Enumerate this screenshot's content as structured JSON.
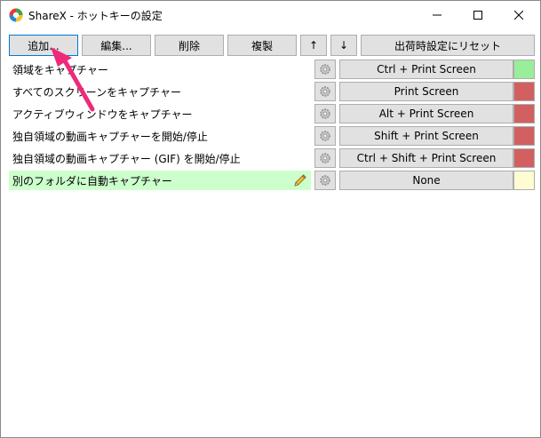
{
  "window": {
    "title": "ShareX - ホットキーの設定"
  },
  "toolbar": {
    "add_label": "追加...",
    "edit_label": "編集...",
    "delete_label": "削除",
    "duplicate_label": "複製",
    "up_label": "↑",
    "down_label": "↓",
    "reset_label": "出荷時設定にリセット"
  },
  "hotkeys": [
    {
      "label": "領域をキャプチャー",
      "hotkey": "Ctrl + Print Screen",
      "status_color": "#99ee99"
    },
    {
      "label": "すべてのスクリーンをキャプチャー",
      "hotkey": "Print Screen",
      "status_color": "#d26060"
    },
    {
      "label": "アクティブウィンドウをキャプチャー",
      "hotkey": "Alt + Print Screen",
      "status_color": "#d26060"
    },
    {
      "label": "独自領域の動画キャプチャーを開始/停止",
      "hotkey": "Shift + Print Screen",
      "status_color": "#d26060"
    },
    {
      "label": "独自領域の動画キャプチャー (GIF) を開始/停止",
      "hotkey": "Ctrl + Shift + Print Screen",
      "status_color": "#d26060"
    },
    {
      "label": "別のフォルダに自動キャプチャー",
      "hotkey": "None",
      "status_color": "#fffbd2"
    }
  ],
  "colors": {
    "selected_row": "#ccffcc",
    "annotation_arrow": "#ee2a7b"
  }
}
